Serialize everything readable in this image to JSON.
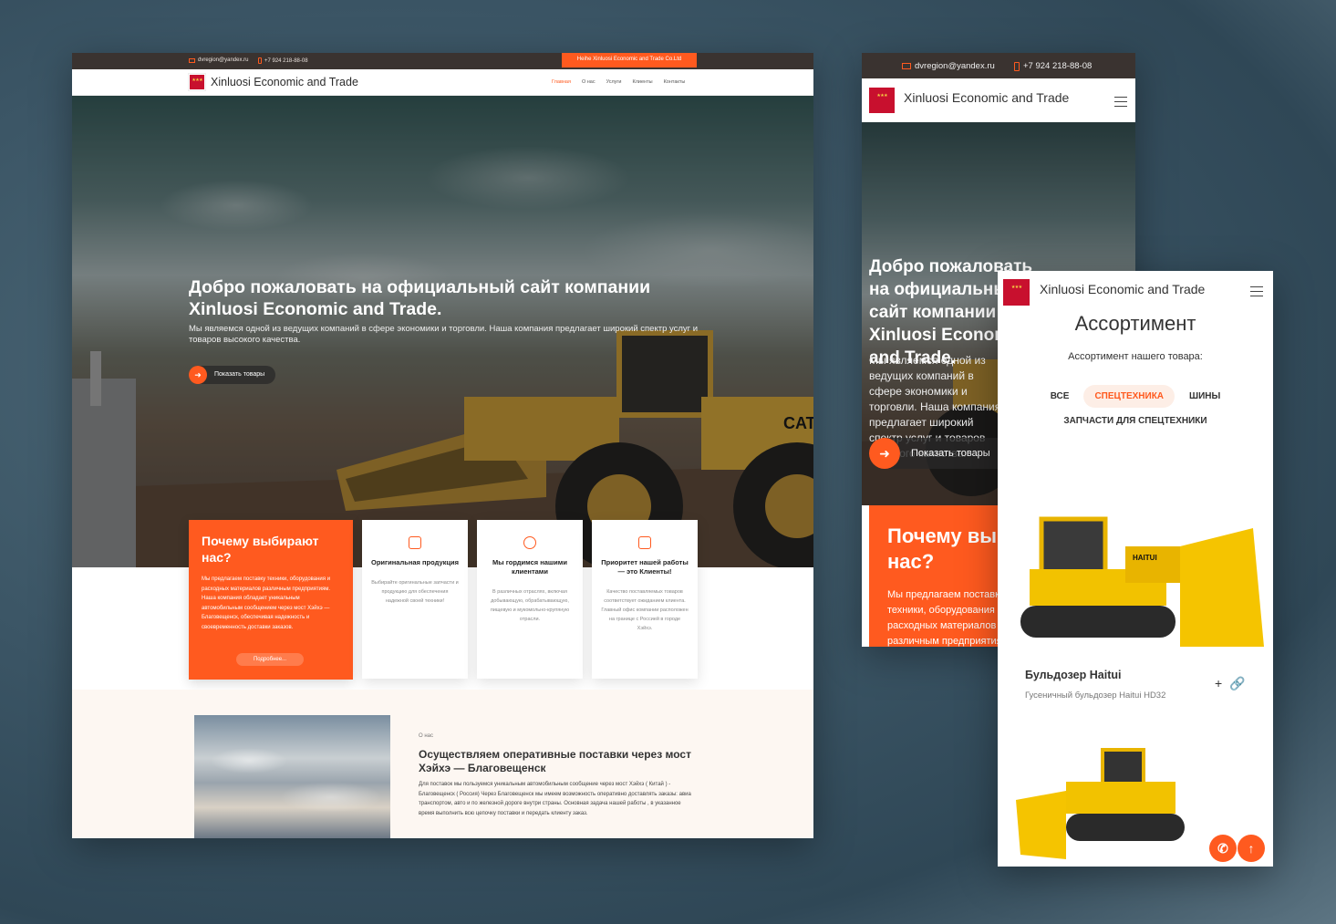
{
  "desktop": {
    "topbar": {
      "email": "dvregion@yandex.ru",
      "phone": "+7 924 218-88-08",
      "ribbon": "Heihe Xinluosi Economic and Trade Co.Ltd"
    },
    "brand": "Xinluosi Economic and Trade",
    "menu": [
      "Главная",
      "О нас",
      "Услуги",
      "Клиенты",
      "Контакты"
    ],
    "hero": {
      "title": "Добро пожаловать на официальный сайт компании Xinluosi Economic and Trade.",
      "subtitle": "Мы являемся одной из ведущих компаний в сфере экономики и торговли. Наша компания предлагает широкий спектр услуг и товаров высокого качества.",
      "button": "Показать товары"
    },
    "why": {
      "title": "Почему выбирают нас?",
      "text": "Мы предлагаем поставку техники, оборудования и расходных материалов различным предприятиям. Наша компания обладает уникальным автомобильным сообщением через мост Хэйхэ — Благовещенск, обеспечивая надежность и своевременность доставки заказов.",
      "more": "Подробнее..."
    },
    "features": [
      {
        "title": "Оригинальная продукция",
        "text": "Выбирайте оригинальные запчасти и продукцию для обеспечения надежной своей техники!"
      },
      {
        "title": "Мы гордимся нашими клиентами",
        "text": "В различных отраслях, включая добывающую, обрабатывающую, пищевую и мукомольно-крупяную отрасли."
      },
      {
        "title": "Приоритет нашей работы — это Клиенты!",
        "text": "Качество поставляемых товаров соответствует ожиданием клиента. Главный офис компании расположен на границе с Россией в городе Хэйхэ."
      }
    ],
    "about": {
      "tag": "О нас",
      "title": "Осуществляем оперативные поставки через мост Хэйхэ — Благовещенск",
      "text": "Для поставок мы пользуемся уникальным автомобильным сообщение через мост Хэйхэ ( Китай ) - Благовещенск ( Россия) Через Благовещенск мы имеем возможность оперативно доставлять заказы: авиа транспортом, авто и по железной дороге внутри страны. Основная задача нашей работы , в указанное время выполнить всю цепочку поставки и передать клиенту заказ."
    }
  },
  "tablet": {
    "email": "dvregion@yandex.ru",
    "phone": "+7 924 218-88-08",
    "brand": "Xinluosi Economic and Trade",
    "hero_title": "Добро пожаловать на официальный сайт компании Xinluosi Economic and Trade.",
    "hero_text": "Мы являемся одной из ведущих компаний в сфере экономики и торговли. Наша компания предлагает широкий спектр услуг и товаров высокого качества.",
    "button": "Показать товары",
    "why_title": "Почему выбирают нас?",
    "why_text": "Мы предлагаем поставку техники, оборудования и расходных материалов различным предприятиям."
  },
  "phone": {
    "brand": "Xinluosi Economic and Trade",
    "title": "Ассортимент",
    "subtitle": "Ассортимент нашего товара:",
    "filters": [
      "ВСЕ",
      "СПЕЦТЕХНИКА",
      "ШИНЫ",
      "ЗАПЧАСТИ ДЛЯ СПЕЦТЕХНИКИ"
    ],
    "active_filter": "СПЕЦТЕХНИКА",
    "product": {
      "name": "Бульдозер Haitui",
      "desc": "Гусеничный бульдозер Haitui HD32",
      "decal": "HAITUI"
    }
  },
  "colors": {
    "accent": "#ff5a1f",
    "topbar": "#3a3330",
    "background": "#3b5565"
  },
  "icons": [
    "mail-icon",
    "phone-icon",
    "arrow-right-icon",
    "menu-icon",
    "plus-icon",
    "link-icon",
    "call-icon",
    "arrow-up-icon"
  ]
}
